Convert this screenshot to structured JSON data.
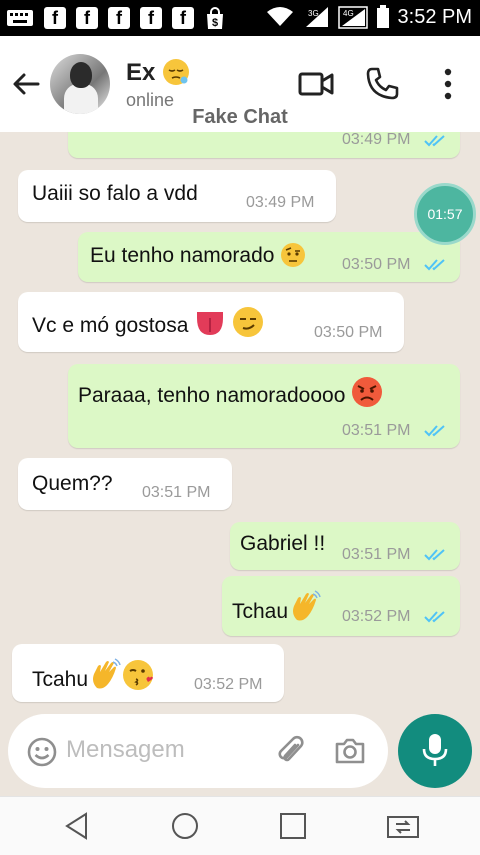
{
  "status_bar": {
    "time": "3:52 PM",
    "network_labels": [
      "3G",
      "4G"
    ],
    "notification_icons": [
      "facebook-icon",
      "facebook-icon",
      "facebook-icon",
      "facebook-icon",
      "facebook-icon",
      "shopping-bag-icon"
    ]
  },
  "header": {
    "contact_name": "Ex",
    "contact_status": "online",
    "app_label": "Fake Chat",
    "actions": [
      "video-call-icon",
      "phone-call-icon",
      "more-options-icon"
    ]
  },
  "messages": [
    {
      "direction": "out",
      "text": "",
      "time": "03:49 PM",
      "read": true
    },
    {
      "direction": "in",
      "text": "Uaiii so falo a vdd",
      "time": "03:49 PM"
    },
    {
      "direction": "out",
      "text": "Eu tenho namorado",
      "emoji": [
        "raised-eyebrow-face"
      ],
      "time": "03:50 PM",
      "read": true
    },
    {
      "direction": "in",
      "text": "Vc e mó gostosa",
      "emoji": [
        "tongue",
        "smirking-face"
      ],
      "time": "03:50 PM"
    },
    {
      "direction": "out",
      "text": "Paraaa, tenho namoradoooo",
      "emoji": [
        "pouting-face"
      ],
      "time": "03:51 PM",
      "read": true
    },
    {
      "direction": "in",
      "text": "Quem??",
      "time": "03:51 PM"
    },
    {
      "direction": "out",
      "text": "Gabriel !!",
      "time": "03:51 PM",
      "read": true
    },
    {
      "direction": "out",
      "text": "Tchau",
      "emoji": [
        "waving-hand"
      ],
      "time": "03:52 PM",
      "read": true
    },
    {
      "direction": "in",
      "text": "Tcahu",
      "emoji": [
        "waving-hand",
        "face-blowing-kiss"
      ],
      "time": "03:52 PM"
    }
  ],
  "recording_timer": "01:57",
  "composer": {
    "placeholder": "Mensagem",
    "icons": [
      "emoji-icon",
      "attach-icon",
      "camera-icon",
      "mic-icon"
    ]
  },
  "colors": {
    "chat_background": "#ece5dd",
    "outgoing_bubble": "#dcf8c6",
    "incoming_bubble": "#ffffff",
    "read_ticks": "#4fc3f7",
    "accent": "#128c7e"
  }
}
